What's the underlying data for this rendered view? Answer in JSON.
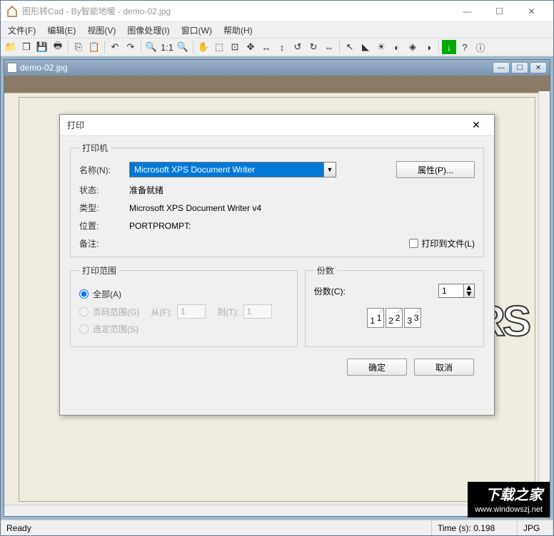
{
  "window": {
    "title": "图形转Cad - By智能地暖 - demo-02.jpg",
    "min": "—",
    "max": "☐",
    "close": "✕"
  },
  "menu": {
    "file": "文件(F)",
    "edit": "编辑(E)",
    "view": "视图(V)",
    "image": "图像处理(I)",
    "window": "窗口(W)",
    "help": "帮助(H)"
  },
  "doc": {
    "title": "demo-02.jpg"
  },
  "bg": {
    "rs": "RS"
  },
  "dialog": {
    "title": "打印",
    "close": "✕",
    "printer_legend": "打印机",
    "name_label": "名称(N):",
    "name_value": "Microsoft XPS Document Writer",
    "properties": "属性(P)...",
    "status_label": "状态:",
    "status_value": "准备就绪",
    "type_label": "类型:",
    "type_value": "Microsoft XPS Document Writer v4",
    "where_label": "位置:",
    "where_value": "PORTPROMPT:",
    "comment_label": "备注:",
    "to_file": "打印到文件(L)",
    "range_legend": "打印范围",
    "range_all": "全部(A)",
    "range_pages": "页码范围(G)",
    "from_label": "从(F):",
    "from_value": "1",
    "to_label": "到(T):",
    "to_value": "1",
    "range_selection": "选定范围(S)",
    "copies_legend": "份数",
    "copies_label": "份数(C):",
    "copies_value": "1",
    "ok": "确定",
    "cancel": "取消"
  },
  "status": {
    "ready": "Ready",
    "time": "Time (s): 0.198",
    "format": "JPG"
  },
  "watermark": {
    "big": "下载之家",
    "small": "www.windowszj.net"
  }
}
